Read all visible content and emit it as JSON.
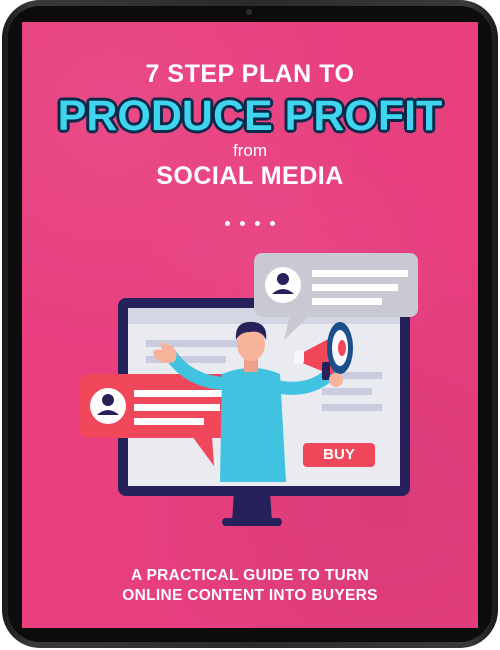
{
  "cover": {
    "title_line1": "7 STEP PLAN TO",
    "title_line2": "PRODUCE PROFIT",
    "title_line3": "from",
    "title_line4": "SOCIAL MEDIA",
    "buy_label": "BUY",
    "subtitle_line1": "A PRACTICAL GUIDE TO TURN",
    "subtitle_line2": "ONLINE CONTENT INTO BUYERS"
  },
  "colors": {
    "background": "#e83f7f",
    "accent": "#3fd5ee",
    "navy": "#26215a",
    "bubble_red": "#f0475a",
    "bubble_gray": "#c9c9d4",
    "screen_bg": "#eaeaf1"
  },
  "icons": [
    "user-avatar-icon",
    "megaphone-icon"
  ]
}
